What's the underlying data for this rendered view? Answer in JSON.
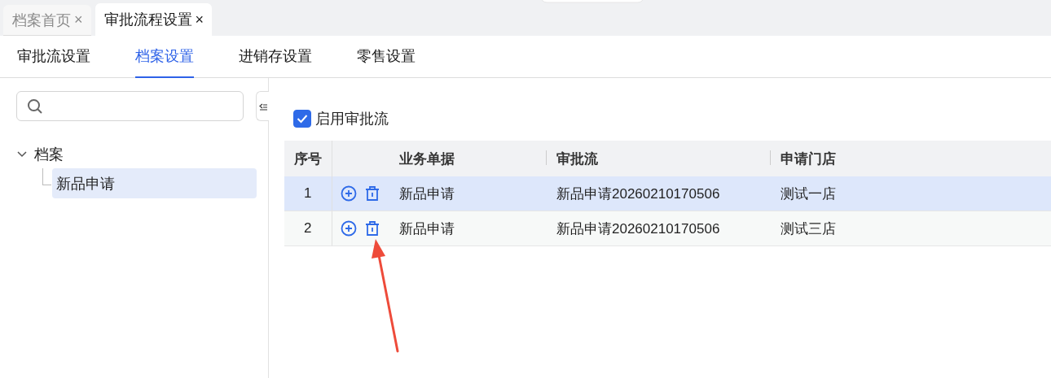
{
  "window_tabs": [
    {
      "label": "档案首页",
      "close": "×",
      "selected": false
    },
    {
      "label": "审批流程设置",
      "close": "×",
      "selected": true
    }
  ],
  "sub_tabs": [
    {
      "label": "审批流设置",
      "selected": false
    },
    {
      "label": "档案设置",
      "selected": true
    },
    {
      "label": "进销存设置",
      "selected": false
    },
    {
      "label": "零售设置",
      "selected": false
    }
  ],
  "tree": [
    {
      "label": "档案",
      "expanded": true,
      "selected": false,
      "children": [
        {
          "label": "新品申请",
          "selected": true
        }
      ]
    }
  ],
  "enable_checkbox": {
    "label": "启用审批流",
    "checked": true
  },
  "table": {
    "columns": [
      "序号",
      "业务单据",
      "审批流",
      "申请门店"
    ],
    "rows": [
      {
        "index": "1",
        "document": "新品申请",
        "flow": "新品申请20260210170506",
        "store": "测试一店",
        "selected": true
      },
      {
        "index": "2",
        "document": "新品申请",
        "flow": "新品申请20260210170506",
        "store": "测试三店",
        "selected": false
      }
    ]
  }
}
